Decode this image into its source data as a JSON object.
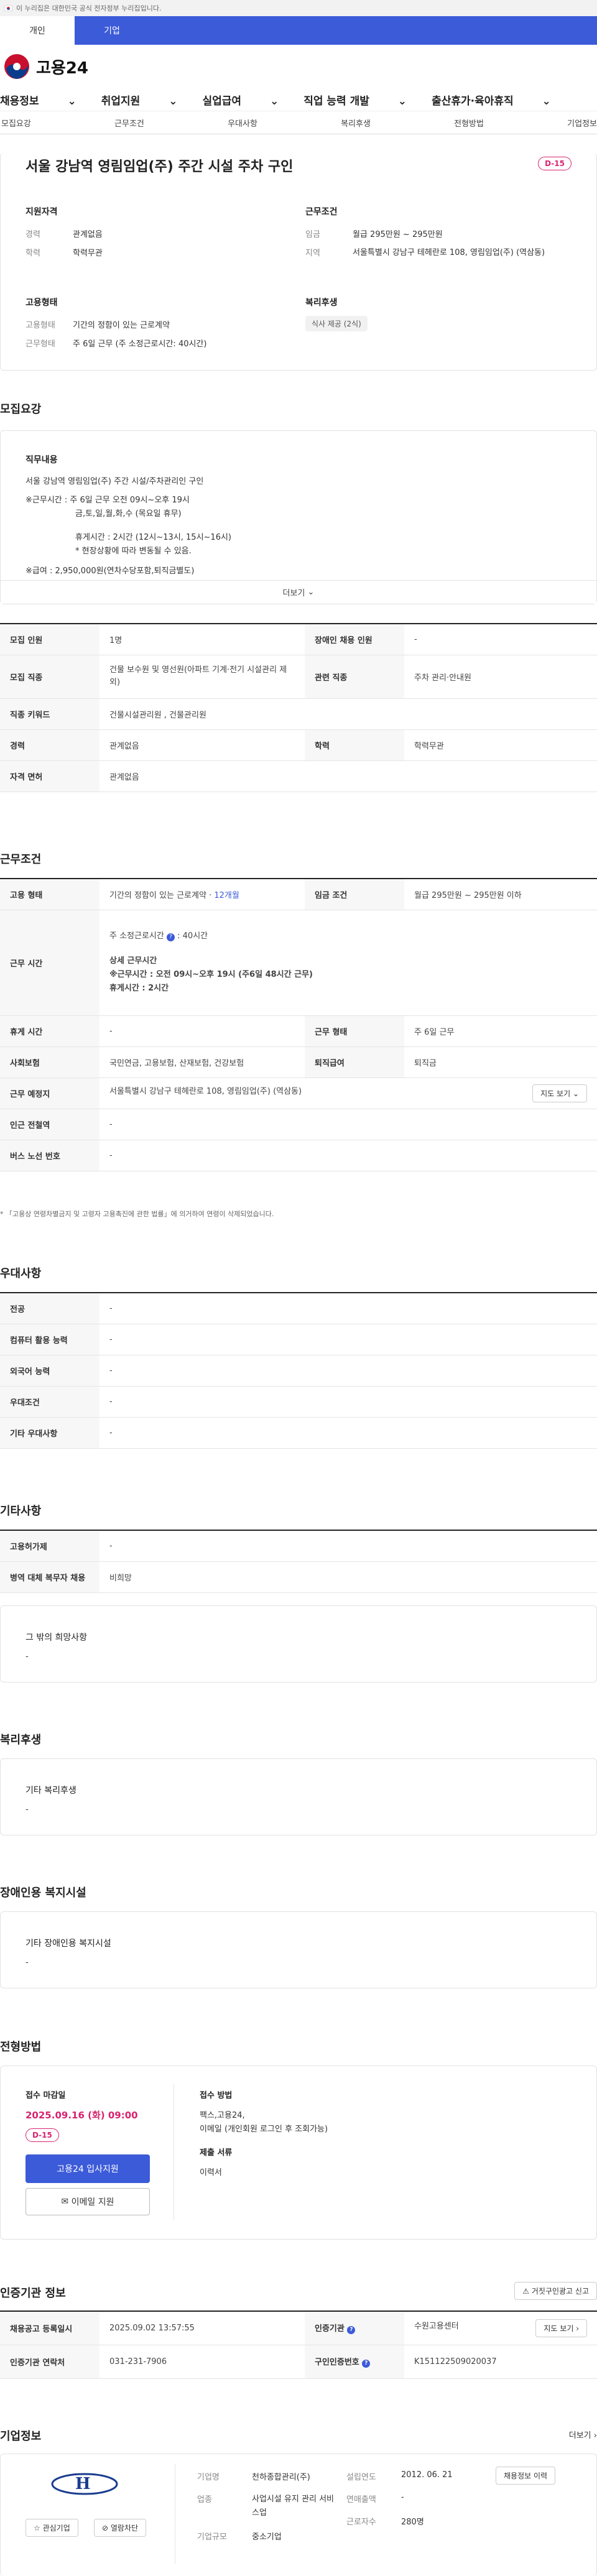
{
  "gov_banner": "이 누리집은 대한민국 공식 전자정부 누리집입니다.",
  "user_tabs": [
    "개인",
    "기업"
  ],
  "logo": "고용24",
  "gnb": [
    "채용정보",
    "취업지원",
    "실업급여",
    "직업 능력 개발",
    "출산휴가·육아휴직"
  ],
  "subnav": [
    "모집요강",
    "근무조건",
    "우대사항",
    "복리후생",
    "전형방법",
    "기업정보"
  ],
  "job_title": "서울 강남역 영림임업(주) 주간 시설 주차 구인",
  "dday": "D-15",
  "summary": {
    "qual_h": "지원자격",
    "cond_h": "근무조건",
    "emp_h": "고용형태",
    "wel_h": "복리후생",
    "career_l": "경력",
    "career_v": "관계없음",
    "edu_l": "학력",
    "edu_v": "학력무관",
    "pay_l": "임금",
    "pay_v": "월급 295만원 ~ 295만원",
    "region_l": "지역",
    "region_v": "서울특별시 강남구 테헤란로 108, 영림임업(주) (역삼동)",
    "emptype_l": "고용형태",
    "emptype_v": "기간의 정함이 있는 근로계약",
    "worktype_l": "근무형태",
    "worktype_v": "주 6일 근무 (주 소정근로시간: 40시간)",
    "welfare_tag": "식사 제공 (2식)"
  },
  "recruit": {
    "heading": "모집요강",
    "duty_h": "직무내용",
    "duty_lines": [
      "서울 강남역 영림임업(주) 주간 시설/주차관리인 구인",
      "※근무시간 : 주 6일 근무 오전 09시~오후 19시",
      "금,토,일,월,화,수 (목요일 휴무)",
      "휴게시간 : 2시간 (12시~13시, 15시~16시)",
      "* 현장상황에 따라 변동될 수 있음.",
      "※급여 : 2,950,000원(연차수당포함,퇴직금별도)"
    ],
    "more": "더보기",
    "rows": {
      "count_l": "모집 인원",
      "count_v": "1명",
      "dis_l": "장애인 채용 인원",
      "dis_v": "-",
      "job_l": "모집 직종",
      "job_v": "건물 보수원 및 영선원(아파트 기계·전기 시설관리 제외)",
      "rel_l": "관련 직종",
      "rel_v": "주차 관리·안내원",
      "kw_l": "직종 키워드",
      "kw_v": "건물시설관리원 , 건물관리원",
      "car_l": "경력",
      "car_v": "관계없음",
      "edu_l": "학력",
      "edu_v": "학력무관",
      "lic_l": "자격 면허",
      "lic_v": "관계없음"
    }
  },
  "workcond": {
    "heading": "근무조건",
    "type_l": "고용 형태",
    "type_v": "기간의 정함이 있는 근로계약 · ",
    "type_link": "12개월",
    "wage_l": "임금 조건",
    "wage_v": "월급 295만원 ~ 295만원 이하",
    "time_l": "근무 시간",
    "time_main": "주 소정근로시간",
    "time_hours": ": 40시간",
    "time_detail_h": "상세 근무시간",
    "time_detail1": "※근무시간 : 오전 09시~오후 19시 (주6일 48시간 근무)",
    "time_detail2": "휴게시간 : 2시간",
    "rest_l": "휴게 시간",
    "rest_v": "-",
    "form_l": "근무 형태",
    "form_v": "주 6일 근무",
    "ins_l": "사회보험",
    "ins_v": "국민연금, 고용보험, 산재보험, 건강보험",
    "ret_l": "퇴직급여",
    "ret_v": "퇴직금",
    "loc_l": "근무 예정지",
    "loc_v": "서울특별시 강남구 테헤란로 108, 영림임업(주) (역삼동)",
    "map_btn": "지도 보기",
    "sub_l": "인근 전철역",
    "sub_v": "-",
    "bus_l": "버스 노선 번호",
    "bus_v": "-",
    "note": "* 「고용상 연령차별금지 및 고령자 고용촉진에 관한 법률」에 의거하여 연령이 삭제되었습니다."
  },
  "pref": {
    "heading": "우대사항",
    "rows": [
      {
        "l": "전공",
        "v": "-"
      },
      {
        "l": "컴퓨터 활용 능력",
        "v": "-"
      },
      {
        "l": "외국어 능력",
        "v": "-"
      },
      {
        "l": "우대조건",
        "v": "-"
      },
      {
        "l": "기타 우대사항",
        "v": "-"
      }
    ]
  },
  "etc": {
    "heading": "기타사항",
    "emp_l": "고용허가제",
    "emp_v": "-",
    "mil_l": "병역 대체 복무자 채용",
    "mil_v": "비희망",
    "other_h": "그 밖의 희망사항",
    "other_v": "-"
  },
  "welfare": {
    "heading": "복리후생",
    "sub_h": "기타 복리후생",
    "sub_v": "-"
  },
  "disab": {
    "heading": "장애인용 복지시설",
    "sub_h": "기타 장애인용 복지시설",
    "sub_v": "-"
  },
  "select": {
    "heading": "전형방법",
    "deadline_h": "접수 마감일",
    "deadline_v": "2025.09.16 (화) 09:00",
    "dday": "D-15",
    "apply_btn": "고용24 입사지원",
    "email_btn": "이메일 지원",
    "method_h": "접수 방법",
    "method_v1": "팩스,고용24,",
    "method_v2": "이메일 (개인회원 로그인 후 조회가능)",
    "docs_h": "제출 서류",
    "docs_v": "이력서"
  },
  "cert": {
    "heading": "인증기관 정보",
    "report_btn": "거짓구인광고 신고",
    "reg_l": "채용공고 등록일시",
    "reg_v": "2025.09.02 13:57:55",
    "org_l": "인증기관",
    "org_v": "수원고용센터",
    "map_btn": "지도 보기",
    "tel_l": "인증기관 연락처",
    "tel_v": "031-231-7906",
    "no_l": "구인인증번호",
    "no_v": "K151122509020037"
  },
  "company": {
    "heading": "기업정보",
    "more": "더보기",
    "int_btn": "관심기업",
    "block_btn": "열람차단",
    "name_l": "기업명",
    "name_v": "천하종합관리(주)",
    "est_l": "설립연도",
    "est_v": "2012. 06. 21",
    "emp_btn": "채용정보 이력",
    "ind_l": "업종",
    "ind_v": "사업시설 유지 관리 서비스업",
    "sales_l": "연매출액",
    "sales_v": "-",
    "scale_l": "기업규모",
    "scale_v": "중소기업",
    "staff_l": "근로자수",
    "staff_v": "280명"
  },
  "colors": {
    "accent": "#3c5bd9",
    "dday": "#d8236f",
    "link": "#3c5bd9"
  }
}
